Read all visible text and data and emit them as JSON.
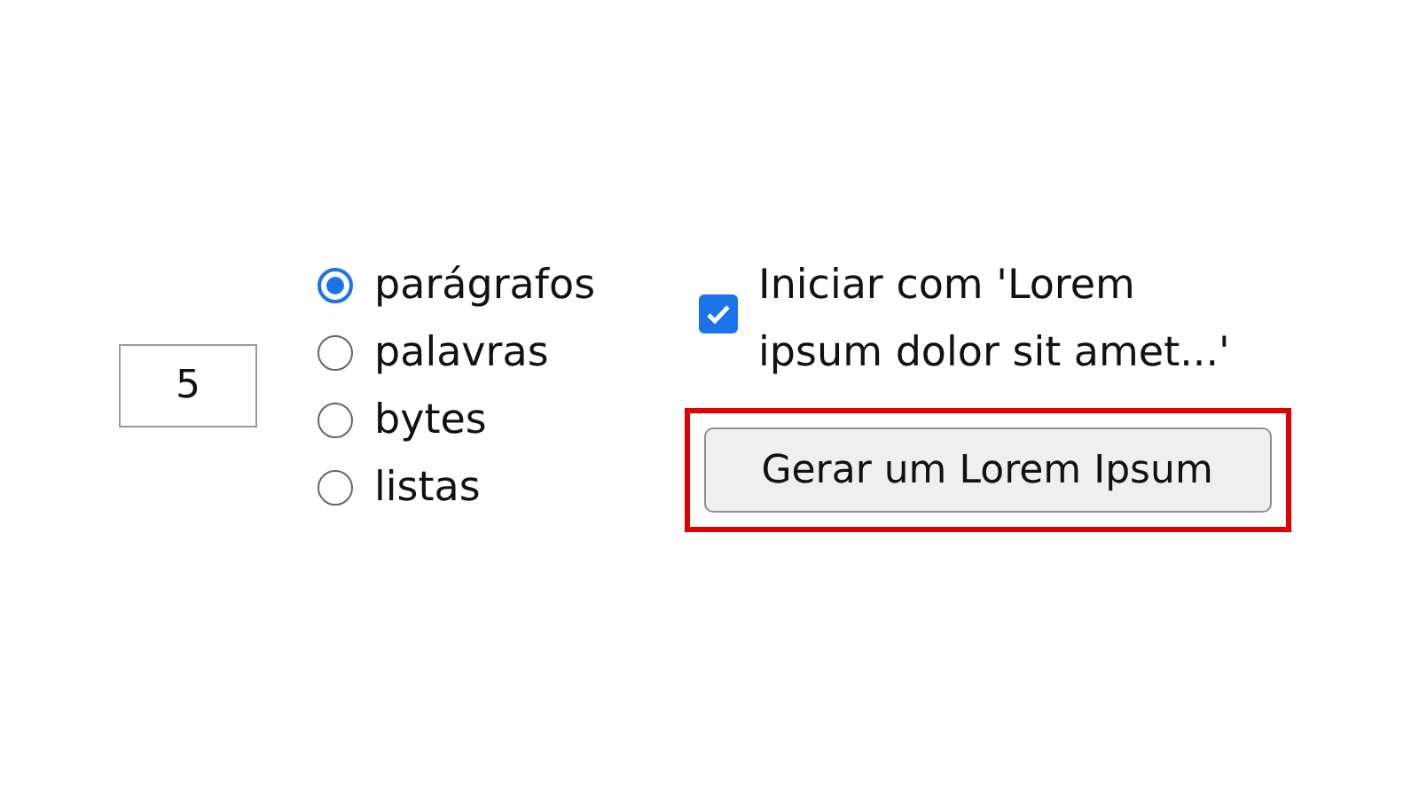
{
  "amount": {
    "value": "5"
  },
  "units": [
    {
      "label": "parágrafos",
      "selected": true
    },
    {
      "label": "palavras",
      "selected": false
    },
    {
      "label": "bytes",
      "selected": false
    },
    {
      "label": "listas",
      "selected": false
    }
  ],
  "start_with_lorem": {
    "label": "Iniciar com 'Lorem ipsum dolor sit amet...'",
    "checked": true
  },
  "generate_button": {
    "label": "Gerar um Lorem Ipsum",
    "highlighted": true
  }
}
